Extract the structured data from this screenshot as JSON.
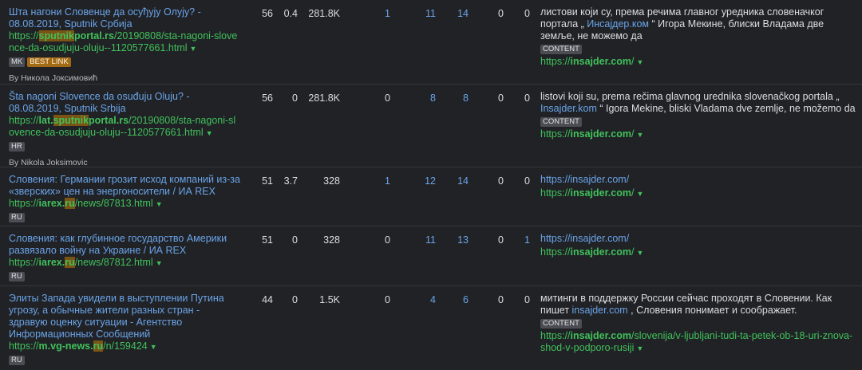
{
  "rows": [
    {
      "title": "Шта нагони Словенце да осуђују Олују? - 08.08.2019, Sputnik Србија",
      "url_pre": "https://",
      "url_hl": "sputnik",
      "url_post": "portal.rs/20190808/sta-nagoni-slovence-da-osudjuju-oluju--1120577661.html",
      "badges": [
        "MK",
        "BEST LINK"
      ],
      "author": "By Никола Јоксимовић",
      "metrics": [
        "56",
        "0.4",
        "281.8K",
        "1",
        "11",
        "14",
        "0",
        "0"
      ],
      "snippet_text": "листови који су, према речима главног уредника словеначког портала „ ",
      "snippet_link": "Инсајдер.ком",
      "snippet_after": " “ Игора Мекине, блиски Владама две земље, не можемо да",
      "content_label": "CONTENT",
      "target_link": "https://insajder.com/"
    },
    {
      "title": "Šta nagoni Slovence da osuđuju Oluju? - 08.08.2019, Sputnik Srbija",
      "url_pre": "https://lat.",
      "url_hl": "sputnik",
      "url_post": "portal.rs/20190808/sta-nagoni-slovence-da-osudjuju-oluju--1120577661.html",
      "badges": [
        "HR"
      ],
      "author": "By Nikola Joksimovic",
      "metrics": [
        "56",
        "0",
        "281.8K",
        "0",
        "8",
        "8",
        "0",
        "0"
      ],
      "snippet_text": "listovi koji su, prema rečima glavnog urednika slovenačkog portala „ ",
      "snippet_link": "Insajder.kom",
      "snippet_after": " “ Igora Mekine, bliski Vladama dve zemlje, ne možemo da",
      "content_label": "CONTENT",
      "target_link": "https://insajder.com/"
    },
    {
      "title": "Словения: Германии грозит исход компаний из-за «зверских» цен на энергоносители / ИА REX",
      "url_pre": "https://iarex.",
      "url_hl": "ru",
      "url_post": "/news/87813.html",
      "badges": [
        "RU"
      ],
      "metrics": [
        "51",
        "3.7",
        "328",
        "1",
        "12",
        "14",
        "0",
        "0"
      ],
      "plain_link": "https://insajder.com/",
      "target_link": "https://insajder.com/"
    },
    {
      "title": "Словения: как глубинное государство Америки развязало войну на Украине / ИА REX",
      "url_pre": "https://iarex.",
      "url_hl": "ru",
      "url_post": "/news/87812.html",
      "badges": [
        "RU"
      ],
      "metrics": [
        "51",
        "0",
        "328",
        "0",
        "11",
        "13",
        "0",
        "1"
      ],
      "plain_link": "https://insajder.com/",
      "target_link": "https://insajder.com/"
    },
    {
      "title": "Элиты Запада увидели в выступлении Путина угрозу, а обычные жители разных стран - здравую оценку ситуации - Агентство Информационных Сообщений",
      "url_pre": "https://m.vg-news.",
      "url_hl": "ru",
      "url_post": "/n/159424",
      "badges": [
        "RU"
      ],
      "metrics": [
        "44",
        "0",
        "1.5K",
        "0",
        "4",
        "6",
        "0",
        "0"
      ],
      "snippet_text": "митинги в поддержку России сейчас проходят в Словении. Как пишет ",
      "snippet_link": "insajder.com",
      "snippet_after": " , Словения понимает и соображает.",
      "content_label": "CONTENT",
      "target_link": "https://insajder.com/slovenija/v-ljubljani-tudi-ta-petek-ob-18-uri-znova-shod-v-podporo-rusiji"
    }
  ]
}
